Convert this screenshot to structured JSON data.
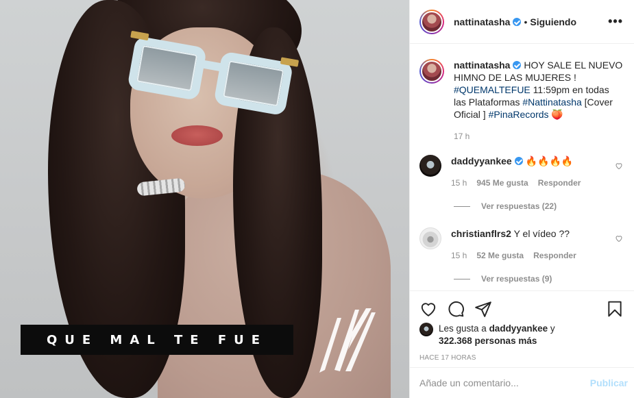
{
  "post": {
    "caption_overlay": "QUE MAL TE FUE"
  },
  "header": {
    "username": "nattinatasha",
    "separator": "•",
    "follow_status": "Siguiendo",
    "more_icon": "more-horizontal-icon"
  },
  "caption": {
    "username": "nattinatasha",
    "text_1": "HOY SALE EL NUEVO HIMNO DE LAS MUJERES ! ",
    "hashtag_1": "#QUEMALTEFUE",
    "text_2": " 11:59pm en todas las Plataformas ",
    "hashtag_2": "#Nattinatasha",
    "text_3": " [Cover Oficial ] ",
    "hashtag_3": "#PinaRecords",
    "emoji": "🍑",
    "time": "17 h"
  },
  "comments": [
    {
      "username": "daddyyankee",
      "verified": true,
      "text": "🔥🔥🔥🔥",
      "time": "15 h",
      "likes": "945 Me gusta",
      "reply": "Responder",
      "view_replies": "Ver respuestas (22)"
    },
    {
      "username": "christianflrs2",
      "verified": false,
      "text": "Y el vídeo ??",
      "time": "15 h",
      "likes": "52 Me gusta",
      "reply": "Responder",
      "view_replies": "Ver respuestas (9)"
    }
  ],
  "likes": {
    "prefix": "Les gusta a ",
    "user": "daddyyankee",
    "middle": " y ",
    "count": "322.368 personas más"
  },
  "timestamp": "HACE 17 HORAS",
  "add_comment": {
    "placeholder": "Añade un comentario...",
    "publish": "Publicar"
  },
  "colors": {
    "verified": "#3897f0",
    "hashtag": "#00376b",
    "publish_disabled": "#b2dffc",
    "muted": "#8e8e8e"
  }
}
